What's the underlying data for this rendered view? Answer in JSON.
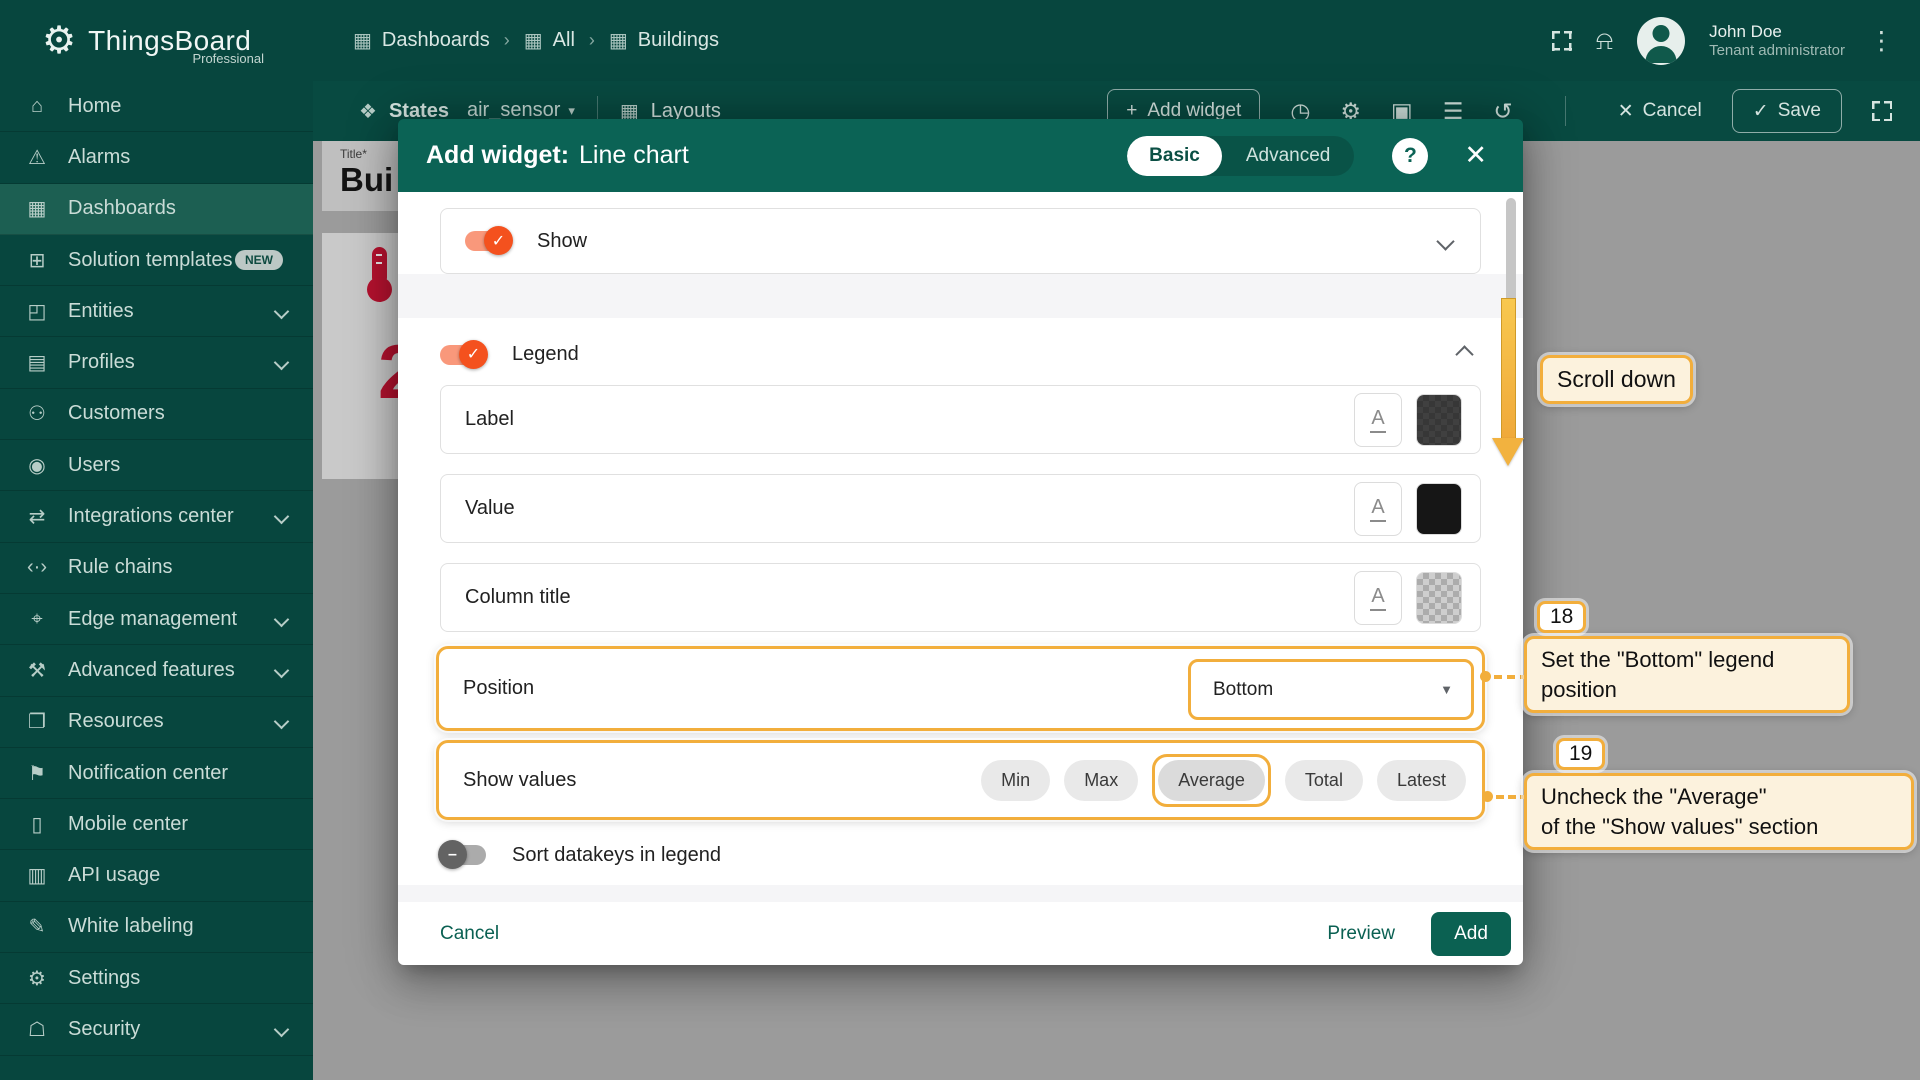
{
  "colors": {
    "brand_teal": "#07463e",
    "modal_teal": "#0b6355",
    "accent_orange": "#f4511e",
    "annotation_gold": "#f2ae3c",
    "alert_red": "#b5122f"
  },
  "icons": {
    "check": "✓",
    "minus": "–",
    "plus": "+",
    "close": "✕",
    "save_check": "✓",
    "help": "?",
    "caret": "▾",
    "select_caret": "▼",
    "breadcrumb_sep": "›",
    "bell": "⍾",
    "kebab": "⋮",
    "logo_gear": "⚙",
    "states": "❖",
    "layouts": "▦",
    "format_text": "A"
  },
  "app": {
    "name": "ThingsBoard",
    "edition": "Professional"
  },
  "topbar": {
    "breadcrumbs": [
      {
        "glyph": "▦",
        "label": "Dashboards",
        "sep": null
      },
      {
        "glyph": "▦",
        "label": "All",
        "sep": "›"
      },
      {
        "glyph": "▦",
        "label": "Buildings",
        "sep": "›"
      }
    ],
    "user": {
      "name": "John Doe",
      "role": "Tenant administrator"
    }
  },
  "toolbar": {
    "states_label": "States",
    "state_value": "air_sensor",
    "layouts_label": "Layouts",
    "add_widget_label": "Add widget",
    "icons": [
      {
        "name": "time-window-icon",
        "glyph": "◷"
      },
      {
        "name": "dashboard-settings-icon",
        "glyph": "⚙"
      },
      {
        "name": "dashboard-image-icon",
        "glyph": "▣"
      },
      {
        "name": "filter-icon",
        "glyph": "☰"
      },
      {
        "name": "version-history-icon",
        "glyph": "↺"
      }
    ],
    "cancel_label": "Cancel",
    "save_label": "Save"
  },
  "sidebar": {
    "items": [
      {
        "glyph": "⌂",
        "label": "Home"
      },
      {
        "glyph": "⚠",
        "label": "Alarms"
      },
      {
        "glyph": "▦",
        "label": "Dashboards",
        "selected": true
      },
      {
        "glyph": "⊞",
        "label": "Solution templates",
        "badge": "NEW"
      },
      {
        "glyph": "◰",
        "label": "Entities",
        "chevron": true
      },
      {
        "glyph": "▤",
        "label": "Profiles",
        "chevron": true
      },
      {
        "glyph": "⚇",
        "label": "Customers"
      },
      {
        "glyph": "◉",
        "label": "Users"
      },
      {
        "glyph": "⇄",
        "label": "Integrations center",
        "chevron": true
      },
      {
        "glyph": "‹·›",
        "label": "Rule chains"
      },
      {
        "glyph": "⌖",
        "label": "Edge management",
        "chevron": true
      },
      {
        "glyph": "⚒",
        "label": "Advanced features",
        "chevron": true
      },
      {
        "glyph": "❐",
        "label": "Resources",
        "chevron": true
      },
      {
        "glyph": "⚑",
        "label": "Notification center"
      },
      {
        "glyph": "▯",
        "label": "Mobile center"
      },
      {
        "glyph": "▥",
        "label": "API usage"
      },
      {
        "glyph": "✎",
        "label": "White labeling"
      },
      {
        "glyph": "⚙",
        "label": "Settings"
      },
      {
        "glyph": "☖",
        "label": "Security",
        "chevron": true
      }
    ]
  },
  "canvas": {
    "title_label": "Title*",
    "title_value": "Bui",
    "widget_value": "2"
  },
  "dialog": {
    "title_prefix": "Add widget:",
    "title": "Line chart",
    "mode": {
      "basic": "Basic",
      "advanced": "Advanced",
      "selected": "Basic"
    },
    "show_section": {
      "label": "Show",
      "enabled": true
    },
    "legend_section": {
      "label": "Legend",
      "enabled": true,
      "rows": [
        {
          "label": "Label",
          "swatch": "dark"
        },
        {
          "label": "Value",
          "swatch": "black"
        },
        {
          "label": "Column title",
          "swatch": "checker"
        }
      ],
      "position": {
        "label": "Position",
        "value": "Bottom"
      },
      "show_values": {
        "label": "Show values",
        "chips": [
          {
            "label": "Min"
          },
          {
            "label": "Max"
          },
          {
            "label": "Average",
            "selected": true,
            "highlighted": true
          },
          {
            "label": "Total"
          },
          {
            "label": "Latest"
          }
        ]
      },
      "sort": {
        "label": "Sort datakeys in legend",
        "enabled": false
      }
    },
    "footer": {
      "cancel": "Cancel",
      "preview": "Preview",
      "add": "Add"
    }
  },
  "annotations": {
    "scroll_label": "Scroll down",
    "step18": {
      "num": "18",
      "line1": "Set the \"Bottom\" legend",
      "line2": "position"
    },
    "step19": {
      "num": "19",
      "line1": "Uncheck the \"Average\"",
      "line2": "of the \"Show values\" section"
    }
  }
}
